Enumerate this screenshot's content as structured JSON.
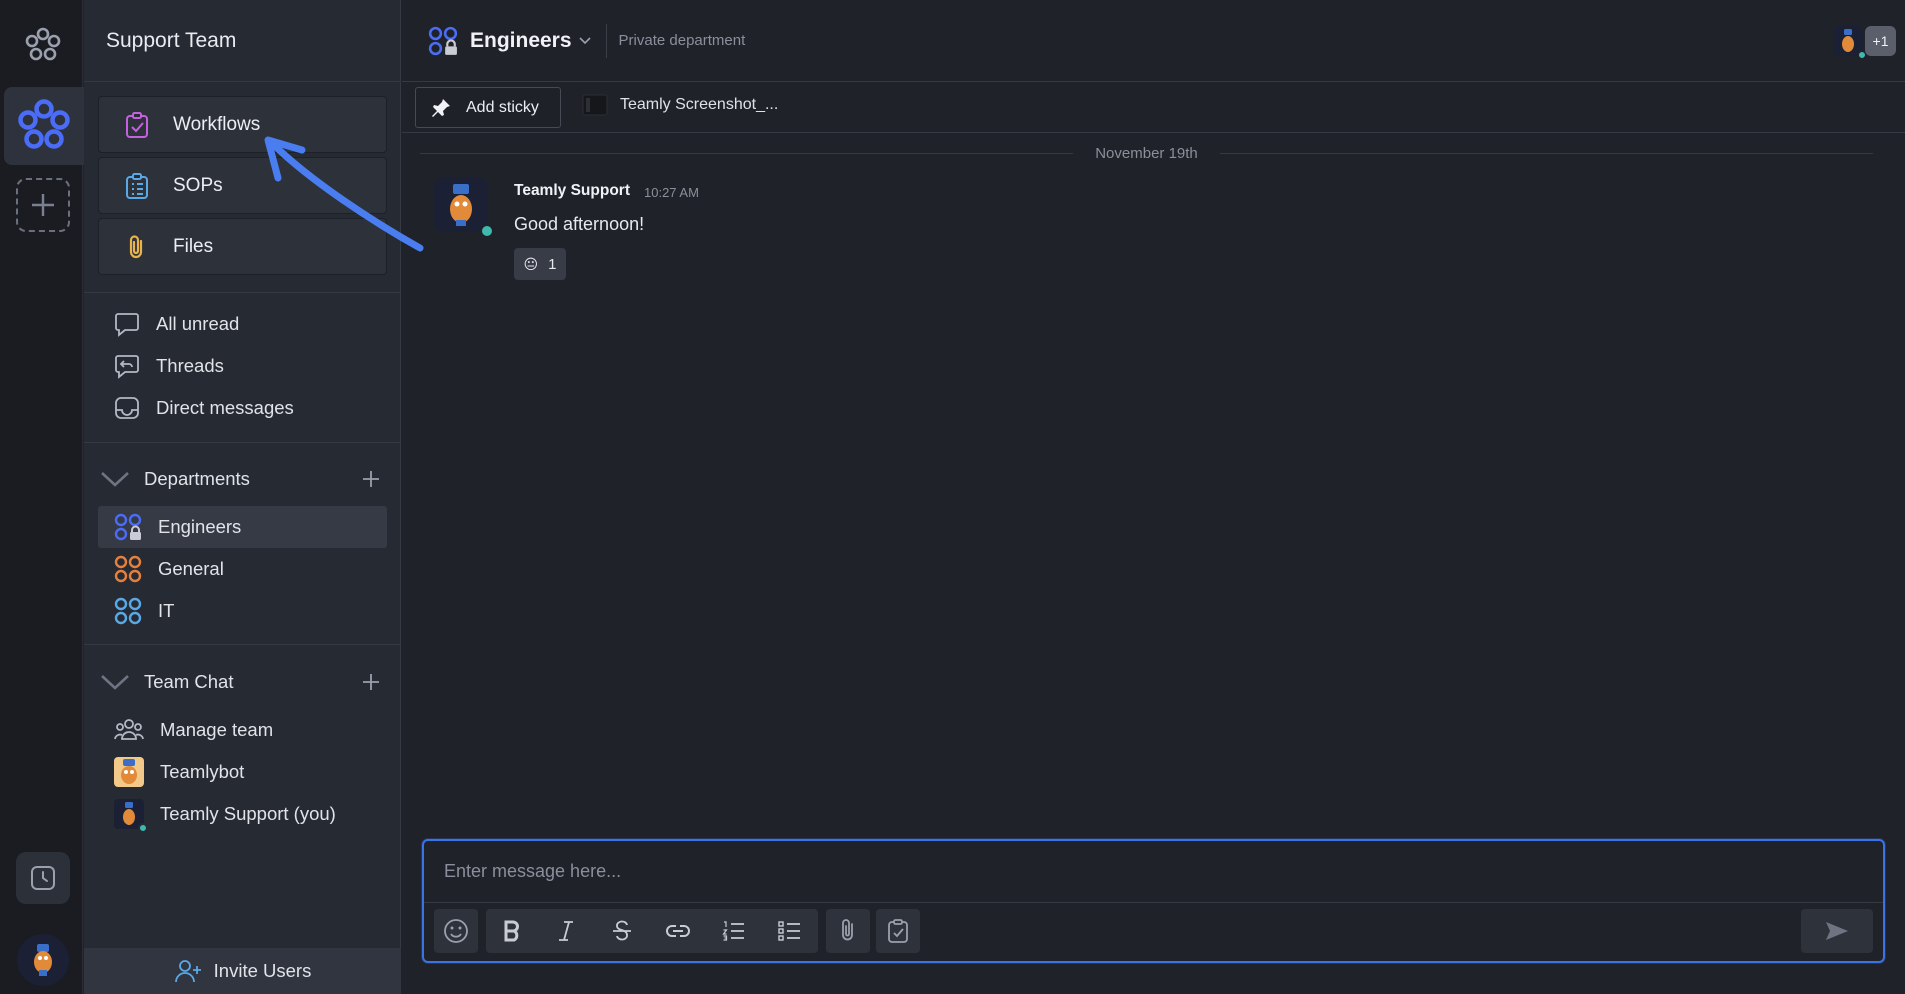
{
  "workspace": {
    "name": "Support Team"
  },
  "features": [
    {
      "label": "Workflows",
      "icon": "clipboard-check-icon",
      "color": "#c561e0"
    },
    {
      "label": "SOPs",
      "icon": "clipboard-list-icon",
      "color": "#5aa9e6"
    },
    {
      "label": "Files",
      "icon": "paperclip-icon",
      "color": "#e8b34a"
    }
  ],
  "nav": [
    {
      "label": "All unread",
      "icon": "chat-bubble-icon"
    },
    {
      "label": "Threads",
      "icon": "thread-icon"
    },
    {
      "label": "Direct messages",
      "icon": "inbox-icon"
    }
  ],
  "departments": {
    "header": "Departments",
    "items": [
      {
        "label": "Engineers",
        "color": "#4a6cf7",
        "private": true,
        "active": true
      },
      {
        "label": "General",
        "color": "#e5803f"
      },
      {
        "label": "IT",
        "color": "#5aa9e6"
      }
    ]
  },
  "team_chat": {
    "header": "Team Chat",
    "items": [
      {
        "label": "Manage team",
        "icon": "team-icon"
      },
      {
        "label": "Teamlybot",
        "icon": "bot-avatar"
      },
      {
        "label": "Teamly Support (you)",
        "icon": "user-avatar"
      }
    ]
  },
  "invite": {
    "label": "Invite Users"
  },
  "channel": {
    "title": "Engineers",
    "subtitle": "Private department",
    "member_extra": "+1"
  },
  "sticky_bar": {
    "add_label": "Add sticky",
    "file_name": "Teamly Screenshot_..."
  },
  "messages": {
    "date": "November 19th",
    "items": [
      {
        "author": "Teamly Support",
        "time": "10:27 AM",
        "text": "Good afternoon!",
        "reaction_emoji": "😐",
        "reaction_count": "1"
      }
    ]
  },
  "composer": {
    "placeholder": "Enter message here..."
  },
  "colors": {
    "accent": "#3a72e8",
    "online": "#3fb8b0",
    "annotation_arrow": "#4a7ef0"
  }
}
